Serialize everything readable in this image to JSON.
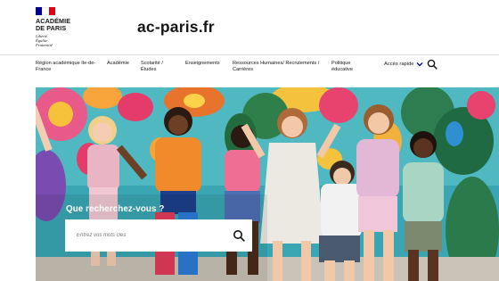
{
  "logo": {
    "title": "ACADÉMIE\nDE PARIS",
    "motto": "Liberté\nÉgalité\nFraternité",
    "flag_colors": [
      "#000091",
      "#ffffff",
      "#e1000f"
    ]
  },
  "site_name": "ac-paris.fr",
  "nav": {
    "items": [
      {
        "label": "Région académique Ile-de-France"
      },
      {
        "label": "Académie"
      },
      {
        "label": "Scolarité / Études"
      },
      {
        "label": "Enseignements"
      },
      {
        "label": "Ressources Humaines/ Recrutements / Carrières"
      },
      {
        "label": "Politique éducative"
      }
    ],
    "quick_access_label": "Accès rapide",
    "search_icon": "search-icon"
  },
  "hero": {
    "search_label": "Que recherchez-vous ?",
    "search_placeholder": "Entrez vos mots clés",
    "image_description": "",
    "colors": {
      "accent": "#000091",
      "overlay_text": "#ffffff"
    }
  }
}
